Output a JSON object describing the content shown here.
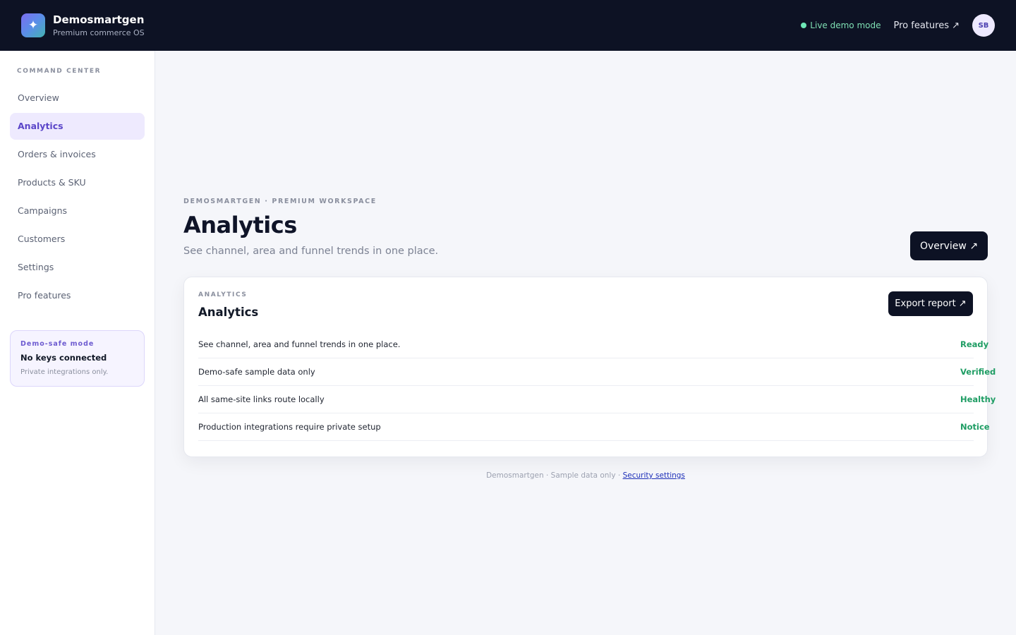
{
  "header": {
    "brand_name": "Demosmartgen",
    "brand_sub": "Premium commerce OS",
    "live_label": "Live demo mode",
    "pro_link": "Pro features ↗",
    "avatar_initials": "SB",
    "logo_glyph": "✦"
  },
  "sidebar": {
    "heading": "COMMAND CENTER",
    "items": [
      {
        "label": "Overview"
      },
      {
        "label": "Analytics"
      },
      {
        "label": "Orders & invoices"
      },
      {
        "label": "Products & SKU"
      },
      {
        "label": "Campaigns"
      },
      {
        "label": "Customers"
      },
      {
        "label": "Settings"
      },
      {
        "label": "Pro features"
      }
    ],
    "active_item": "Analytics",
    "demo_card": {
      "title": "Demo-safe mode",
      "main": "No keys connected",
      "sub": "Private integrations only."
    }
  },
  "main": {
    "eyebrow": "DEMOSMARTGEN · PREMIUM WORKSPACE",
    "title": "Analytics",
    "subtitle": "See channel, area and funnel trends in one place.",
    "overview_button": "Overview ↗",
    "card": {
      "eyebrow": "ANALYTICS",
      "title": "Analytics",
      "export_button": "Export report ↗",
      "rows": [
        {
          "label": "See channel, area and funnel trends in one place.",
          "status": "Ready"
        },
        {
          "label": "Demo-safe sample data only",
          "status": "Verified"
        },
        {
          "label": "All same-site links route locally",
          "status": "Healthy"
        },
        {
          "label": "Production integrations require private setup",
          "status": "Notice"
        }
      ]
    },
    "footer_text": "Demosmartgen · Sample data only · ",
    "footer_link": "Security settings"
  },
  "colors": {
    "topbar_bg": "#0d1224",
    "accent": "#5b46c9",
    "status_green": "#1f9d64",
    "live_green": "#6ee7b7"
  }
}
